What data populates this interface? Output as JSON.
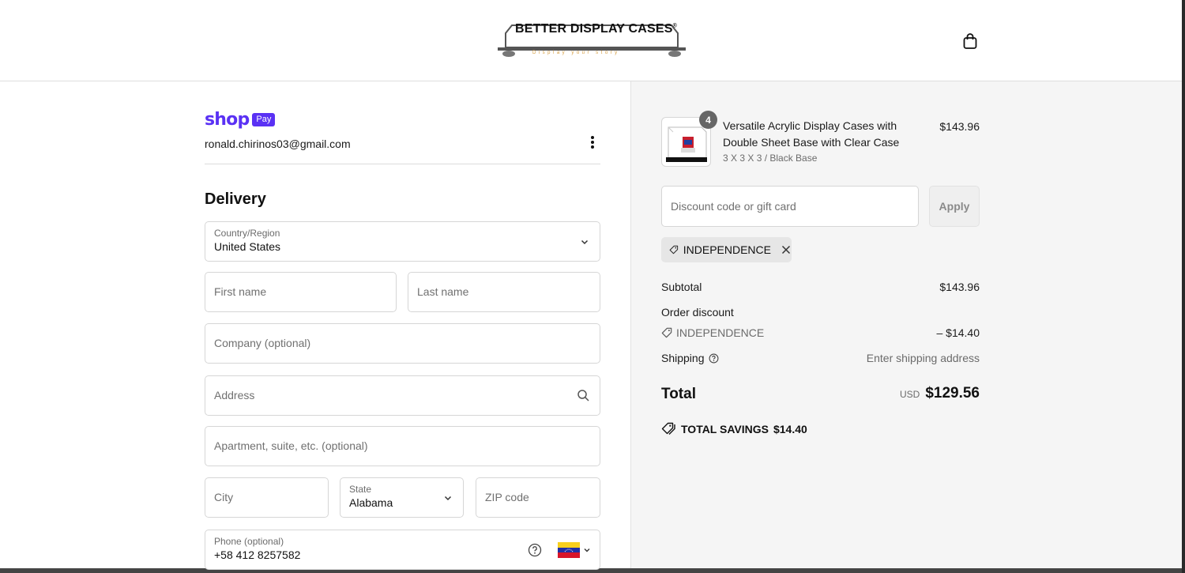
{
  "header": {
    "logo_text": "BETTER DISPLAY CASES",
    "logo_mark": "®",
    "tagline": "Display your story",
    "cart_icon": "shopping-bag-icon"
  },
  "account": {
    "shop_word": "shop",
    "pay_badge": "Pay",
    "email": "ronald.chirinos03@gmail.com"
  },
  "delivery": {
    "title": "Delivery",
    "country": {
      "label": "Country/Region",
      "value": "United States"
    },
    "first_name": {
      "placeholder": "First name"
    },
    "last_name": {
      "placeholder": "Last name"
    },
    "company": {
      "placeholder": "Company (optional)"
    },
    "address": {
      "placeholder": "Address"
    },
    "apartment": {
      "placeholder": "Apartment, suite, etc. (optional)"
    },
    "city": {
      "placeholder": "City"
    },
    "state": {
      "label": "State",
      "value": "Alabama"
    },
    "zip": {
      "placeholder": "ZIP code"
    },
    "phone": {
      "label": "Phone (optional)",
      "value": "+58 412 8257582",
      "flag": "venezuela-flag-icon"
    }
  },
  "summary": {
    "product": {
      "quantity": "4",
      "title": "Versatile Acrylic Display Cases with Double Sheet Base with Clear Case",
      "variant": "3 X 3 X 3 / Black Base",
      "price": "$143.96"
    },
    "discount": {
      "placeholder": "Discount code or gift card",
      "apply_label": "Apply",
      "applied_code": "INDEPENDENCE"
    },
    "subtotal": {
      "label": "Subtotal",
      "value": "$143.96"
    },
    "order_discount": {
      "label": "Order discount",
      "code": "INDEPENDENCE",
      "value": "– $14.40"
    },
    "shipping": {
      "label": "Shipping",
      "value": "Enter shipping address"
    },
    "total": {
      "label": "Total",
      "currency": "USD",
      "value": "$129.56"
    },
    "savings": {
      "label": "TOTAL SAVINGS",
      "value": "$14.40"
    }
  },
  "colors": {
    "shop_pay": "#5a31f4",
    "summary_bg": "#f5f5f5",
    "tagline": "#d69b3c"
  }
}
